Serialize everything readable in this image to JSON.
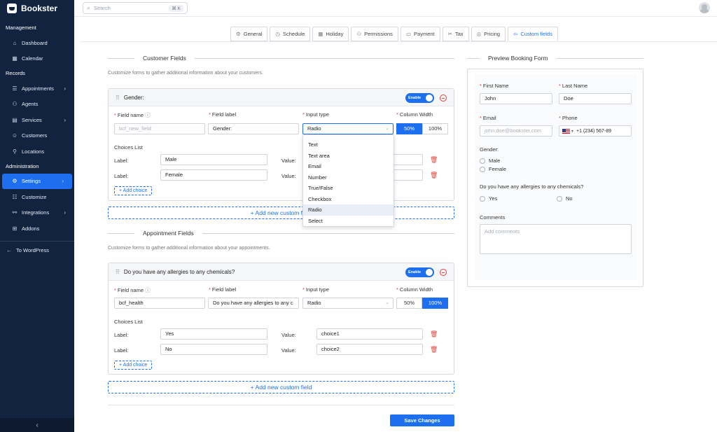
{
  "app": {
    "name": "Bookster"
  },
  "sidebar": {
    "sections": [
      {
        "title": "Management",
        "items": [
          {
            "label": "Dashboard",
            "icon": "dashboard-icon"
          },
          {
            "label": "Calendar",
            "icon": "calendar-icon"
          }
        ]
      },
      {
        "title": "Records",
        "items": [
          {
            "label": "Appointments",
            "icon": "appointments-icon",
            "chevron": true
          },
          {
            "label": "Agents",
            "icon": "agents-icon"
          },
          {
            "label": "Services",
            "icon": "services-icon",
            "chevron": true
          },
          {
            "label": "Customers",
            "icon": "customers-icon"
          },
          {
            "label": "Locations",
            "icon": "locations-icon"
          }
        ]
      },
      {
        "title": "Administration",
        "items": [
          {
            "label": "Settings",
            "icon": "settings-icon",
            "chevron": true,
            "active": true
          },
          {
            "label": "Customize",
            "icon": "customize-icon"
          },
          {
            "label": "Integrations",
            "icon": "integrations-icon",
            "chevron": true
          },
          {
            "label": "Addons",
            "icon": "addons-icon"
          }
        ]
      }
    ],
    "wordpress": "To WordPress"
  },
  "search": {
    "placeholder": "Search",
    "shortcut": "⌘ K"
  },
  "tabs": [
    {
      "label": "General",
      "icon": "⚙"
    },
    {
      "label": "Schedule",
      "icon": "◷"
    },
    {
      "label": "Holiday",
      "icon": "▦"
    },
    {
      "label": "Permissions",
      "icon": "⚇"
    },
    {
      "label": "Payment",
      "icon": "▭"
    },
    {
      "label": "Tax",
      "icon": "✂"
    },
    {
      "label": "Pricing",
      "icon": "◎"
    },
    {
      "label": "Custom fields",
      "icon": "⇦",
      "active": true
    }
  ],
  "customer": {
    "title": "Customer Fields",
    "description": "Customize forms to gather additional information about your customers.",
    "card": {
      "name": "Gender:",
      "enable": "Enable",
      "field_name_label": "Field name",
      "field_label_label": "Field label",
      "input_type_label": "Input type",
      "column_width_label": "Column Width",
      "field_name_placeholder": "bcf_new_field",
      "field_label_value": "Gender:",
      "input_type_value": "Radio",
      "width_50": "50%",
      "width_100": "100%",
      "selected_width": "50%",
      "choices_title": "Choices List",
      "label_text": "Label:",
      "value_text": "Value:",
      "choices": [
        {
          "label": "Male",
          "value": ""
        },
        {
          "label": "Female",
          "value": ""
        }
      ],
      "add_choice": "Add choice"
    },
    "add_field": "Add new custom field",
    "dropdown": {
      "options": [
        "Text",
        "Text area",
        "Email",
        "Number",
        "True/False",
        "Checkbox",
        "Radio",
        "Select"
      ],
      "selected": "Radio"
    }
  },
  "appointment": {
    "title": "Appointment Fields",
    "description": "Customize forms to gather additional information about your appointments.",
    "card": {
      "name": "Do you have any allergies to any chemicals?",
      "enable": "Enable",
      "field_name_label": "Field name",
      "field_label_label": "Field label",
      "input_type_label": "Input type",
      "column_width_label": "Column Width",
      "field_name_value": "bcf_health",
      "field_label_value": "Do you have any allergies to any c",
      "input_type_value": "Radio",
      "width_50": "50%",
      "width_100": "100%",
      "selected_width": "100%",
      "choices_title": "Choices List",
      "label_text": "Label:",
      "value_text": "Value:",
      "choices": [
        {
          "label": "Yes",
          "value": "choice1"
        },
        {
          "label": "No",
          "value": "choice2"
        }
      ],
      "add_choice": "Add choice"
    },
    "add_field": "Add new custom field"
  },
  "save": "Save Changes",
  "preview": {
    "title": "Preview Booking Form",
    "first_name_label": "First Name",
    "first_name": "John",
    "last_name_label": "Last Name",
    "last_name": "Doe",
    "email_label": "Email",
    "email_placeholder": "john.doe@bookster.com",
    "phone_label": "Phone",
    "phone_value": "+1 (234) 567-89",
    "gender_label": "Gender:",
    "gender_options": [
      "Male",
      "Female"
    ],
    "allergy_label": "Do you have any allergies to any chemicals?",
    "allergy_options": [
      "Yes",
      "No"
    ],
    "comments_label": "Comments",
    "comments_placeholder": "Add comments"
  }
}
